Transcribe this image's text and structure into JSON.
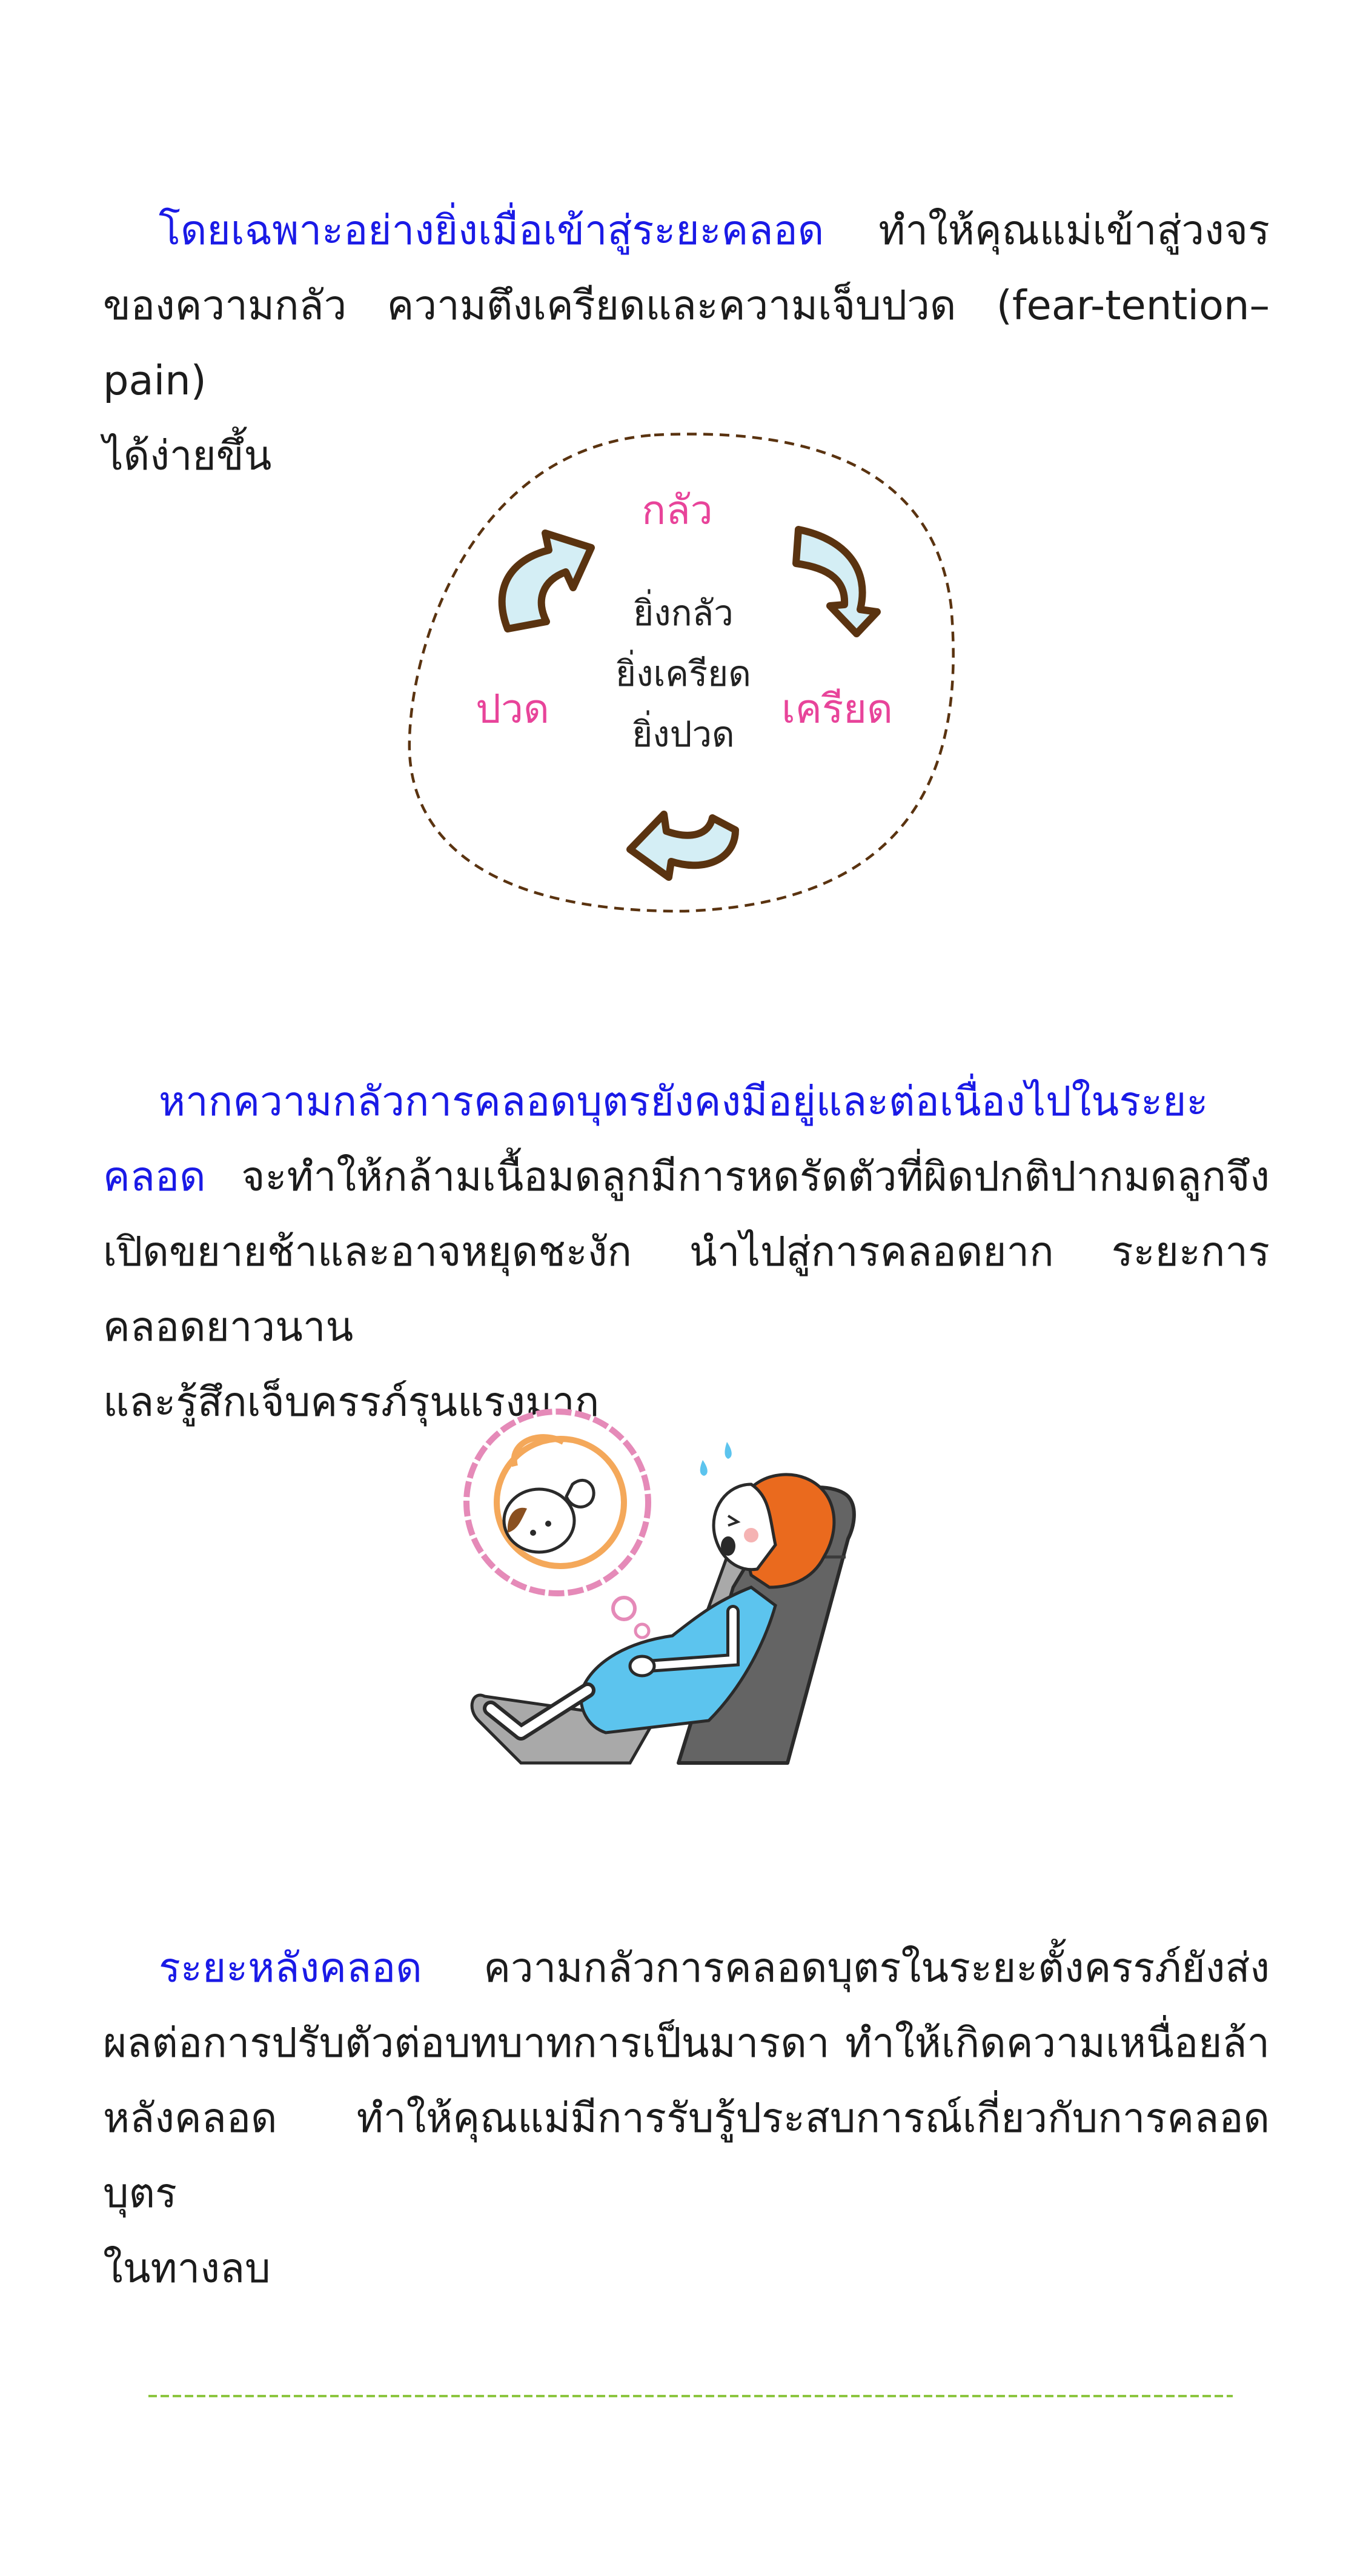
{
  "para1": {
    "highlight": "โดยเฉพาะอย่างยิ่งเมื่อเข้าสู่ระยะคลอด",
    "body": " ทำให้คุณแม่เข้าสู่วงจรของความกลัว ความตึงเครียดและความเจ็บปวด (fear-tention–pain)",
    "last": "ได้ง่ายขึ้น"
  },
  "cycle": {
    "top": "กลัว",
    "right": "เครียด",
    "left": "ปวด",
    "center": [
      "ยิ่งกลัว",
      "ยิ่งเครียด",
      "ยิ่งปวด"
    ],
    "colors": {
      "labels": "#e8449a",
      "arrow_fill": "#d4eef5",
      "arrow_stroke": "#5a3310",
      "border": "#5a3310"
    }
  },
  "para2": {
    "highlight": "หากความกลัวการคลอดบุตรยังคงมีอยู่และต่อเนื่องไปในระยะคลอด",
    "body": " จะทำให้กล้ามเนื้อมดลูกมีการหดรัดตัวที่ผิดปกติปากมดลูกจึงเปิดขยายช้าและอาจหยุดชะงัก นำไปสู่การคลอดยาก ระยะการคลอดยาวนาน",
    "last": "และรู้สึกเจ็บครรภ์รุนแรงมาก"
  },
  "illustration": {
    "icon": "woman-in-labor-illustration",
    "colors": {
      "hair": "#ea6a1e",
      "shirt": "#5cc4ee",
      "chair": "#646464",
      "bubble": "#e58ab8",
      "uterus": "#f4a85a"
    }
  },
  "para3": {
    "highlight": "ระยะหลังคลอด",
    "body": "  ความกลัวการคลอดบุตรในระยะตั้งครรภ์ยังส่งผลต่อการปรับตัวต่อบทบาทการเป็นมารดา ทำให้เกิดความเหนื่อยล้าหลังคลอด ทำให้คุณแม่มีการรับรู้ประสบการณ์เกี่ยวกับการคลอดบุตร",
    "last": "ในทางลบ"
  },
  "colors": {
    "highlight": "#1a1ae6",
    "divider": "#8cc63f"
  }
}
